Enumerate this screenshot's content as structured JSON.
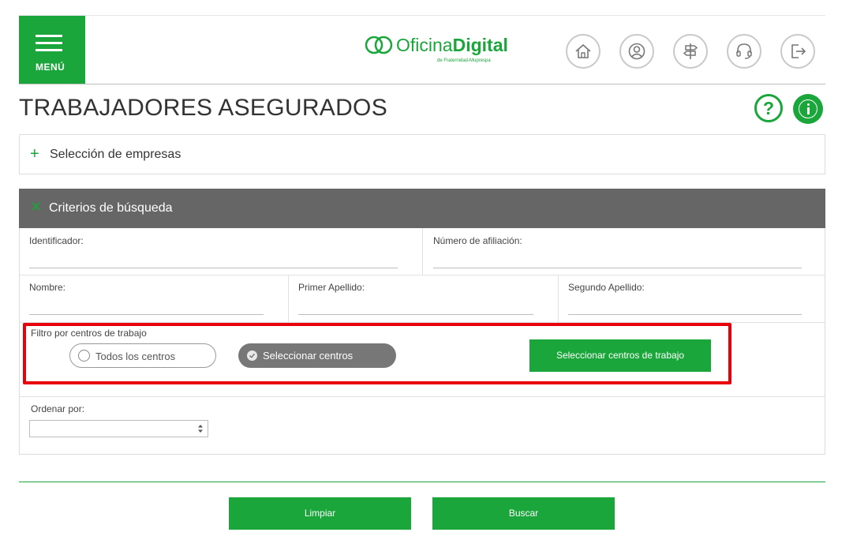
{
  "header": {
    "menu_label": "MENÚ",
    "logo": {
      "text_light": "Oficina",
      "text_bold": "Digital",
      "tagline": "de Fraternidad-Muprespa"
    },
    "icons": [
      "home-icon",
      "user-icon",
      "signpost-icon",
      "headset-icon",
      "logout-icon"
    ]
  },
  "page": {
    "title": "TRABAJADORES ASEGURADOS",
    "help_glyph": "?"
  },
  "empresas_panel": {
    "toggle_glyph": "+",
    "label": "Selección de empresas"
  },
  "criterios_panel": {
    "toggle_glyph": "✕",
    "label": "Criterios de búsqueda"
  },
  "form": {
    "identificador": {
      "label": "Identificador:",
      "value": ""
    },
    "numero_afiliacion": {
      "label": "Número de afiliación:",
      "value": ""
    },
    "nombre": {
      "label": "Nombre:",
      "value": ""
    },
    "primer_apellido": {
      "label": "Primer Apellido:",
      "value": ""
    },
    "segundo_apellido": {
      "label": "Segundo Apellido:",
      "value": ""
    },
    "filtro": {
      "label": "Filtro por centros de trabajo",
      "option_todos": "Todos los centros",
      "option_seleccionar": "Seleccionar centros",
      "selected": "Seleccionar centros",
      "select_button": "Seleccionar centros de trabajo"
    },
    "ordenar": {
      "label": "Ordenar por:",
      "value": ""
    }
  },
  "actions": {
    "limpiar": "Limpiar",
    "buscar": "Buscar"
  },
  "colors": {
    "brand_green": "#1aa63a",
    "panel_header_gray": "#666666",
    "highlight_red": "#e8000b"
  }
}
